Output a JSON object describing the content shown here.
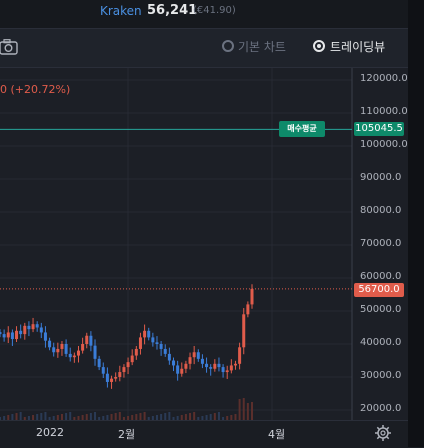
{
  "header": {
    "exchange": "Kraken",
    "price": "56,241",
    "krw_price": "(€41.90)"
  },
  "toolbar": {
    "basic_chart_label": "기본 차트",
    "tradingview_label": "트레이딩뷰",
    "selected": "트레이딩뷰"
  },
  "chart_overlay": {
    "change_text": "0 (+20.72%)",
    "avg_buy_label": "매수평균",
    "avg_buy_price": "105045.5",
    "current_price": "56700.0"
  },
  "colors": {
    "up": "#e05c4b",
    "down": "#3b7dd8",
    "avg_line": "#26a69a",
    "avg_tag": "#0e8a6a"
  },
  "chart_data": {
    "type": "candlestick",
    "y_ticks": [
      "120000.0",
      "110000.0",
      "100000.0",
      "90000.0",
      "80000.0",
      "70000.0",
      "60000.0",
      "50000.0",
      "40000.0",
      "30000.0",
      "20000.0"
    ],
    "x_ticks": [
      "2022",
      "2월",
      "4월"
    ],
    "ylim": [
      20000,
      120000
    ],
    "avg_buy_price": 105045.5,
    "current_price": 56700.0,
    "grid": true,
    "close_series": [
      43000,
      42000,
      43500,
      41500,
      44000,
      43000,
      45500,
      44500,
      46000,
      45000,
      43500,
      41000,
      39000,
      37500,
      38500,
      40000,
      37000,
      36000,
      36500,
      38000,
      40000,
      42500,
      39500,
      35500,
      33000,
      31000,
      28500,
      29500,
      30000,
      31500,
      33000,
      34500,
      36500,
      38500,
      42000,
      44000,
      42000,
      40500,
      40000,
      38500,
      37000,
      35000,
      33500,
      31000,
      32500,
      34000,
      36000,
      37500,
      35500,
      34000,
      33000,
      32500,
      34000,
      33000,
      31500,
      32000,
      33500,
      34000,
      39000,
      49000,
      52000,
      56700
    ]
  }
}
